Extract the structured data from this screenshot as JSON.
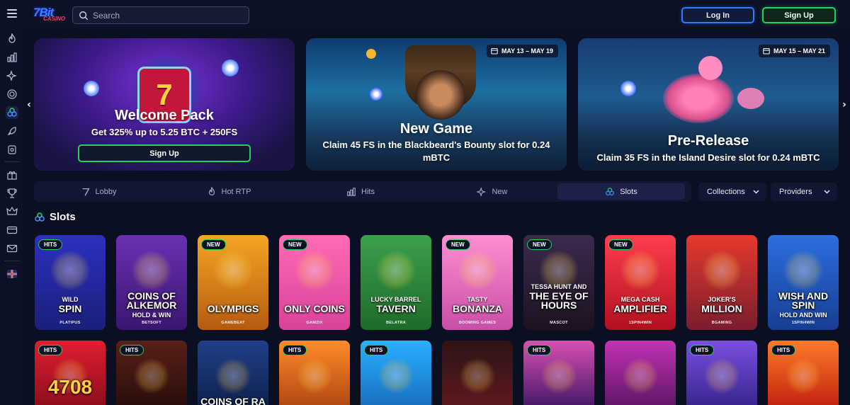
{
  "header": {
    "logo_top": "7Bit",
    "logo_bottom": "CASINO",
    "search_placeholder": "Search",
    "login_label": "Log In",
    "signup_label": "Sign Up"
  },
  "sidebar": {
    "icons": [
      "flame-icon",
      "chart-icon",
      "sparkle-icon",
      "target-icon",
      "slots-icon",
      "rocket-icon",
      "live-icon",
      "gift-icon",
      "trophy-icon",
      "crown-icon",
      "card-icon",
      "mail-icon",
      "flag-icon"
    ]
  },
  "banners": [
    {
      "title": "Welcome Pack",
      "subtitle": "Get 325% up to 5.25 BTC + 250FS",
      "button": "Sign Up"
    },
    {
      "title": "New Game",
      "subtitle": "Claim 45 FS in the Blackbeard's Bounty slot for 0.24 mBTC",
      "date": "MAY 13 – MAY 19"
    },
    {
      "title": "Pre-Release",
      "subtitle": "Claim 35 FS in the Island Desire slot for 0.24 mBTC",
      "date": "MAY 15 – MAY 21"
    }
  ],
  "nav": {
    "tabs": [
      "Lobby",
      "Hot RTP",
      "Hits",
      "New",
      "Slots"
    ],
    "active_tab": "Slots",
    "collections_label": "Collections",
    "providers_label": "Providers"
  },
  "section": {
    "title": "Slots"
  },
  "games_row1": [
    {
      "badge": "HITS",
      "name": "SPIN",
      "sub": "WILD",
      "provider": "PLATIPUS"
    },
    {
      "badge": "",
      "name": "COINS OF ALKEMOR",
      "sub": "HOLD & WIN",
      "provider": "BETSOFT"
    },
    {
      "badge": "NEW",
      "name": "OLYMPIGS",
      "sub": "",
      "provider": "GAMEBEAT"
    },
    {
      "badge": "NEW",
      "name": "ONLY COINS",
      "sub": "",
      "provider": "GAMZIX"
    },
    {
      "badge": "",
      "name": "TAVERN",
      "sub": "LUCKY BARREL",
      "provider": "BELATRA"
    },
    {
      "badge": "NEW",
      "name": "BONANZA",
      "sub": "TASTY",
      "provider": "BOOMING GAMES"
    },
    {
      "badge": "NEW",
      "name": "THE EYE OF HOURS",
      "sub": "TESSA HUNT AND",
      "provider": "MASCOT"
    },
    {
      "badge": "NEW",
      "name": "AMPLIFIER",
      "sub": "MEGA CASH",
      "provider": "1SPIN4WIN"
    },
    {
      "badge": "",
      "name": "MILLION",
      "sub": "JOKER'S",
      "provider": "BGAMING"
    },
    {
      "badge": "",
      "name": "WISH AND SPIN",
      "sub": "HOLD AND WIN",
      "provider": "1SPIN4WIN"
    }
  ],
  "games_row2": [
    {
      "badge": "HITS",
      "name": "4708"
    },
    {
      "badge": "HITS",
      "name": ""
    },
    {
      "badge": "",
      "name": "COINS OF RA"
    },
    {
      "badge": "HITS",
      "name": ""
    },
    {
      "badge": "HITS",
      "name": ""
    },
    {
      "badge": "",
      "name": ""
    },
    {
      "badge": "HITS",
      "name": ""
    },
    {
      "badge": "",
      "name": ""
    },
    {
      "badge": "HITS",
      "name": ""
    },
    {
      "badge": "HITS",
      "name": ""
    }
  ]
}
